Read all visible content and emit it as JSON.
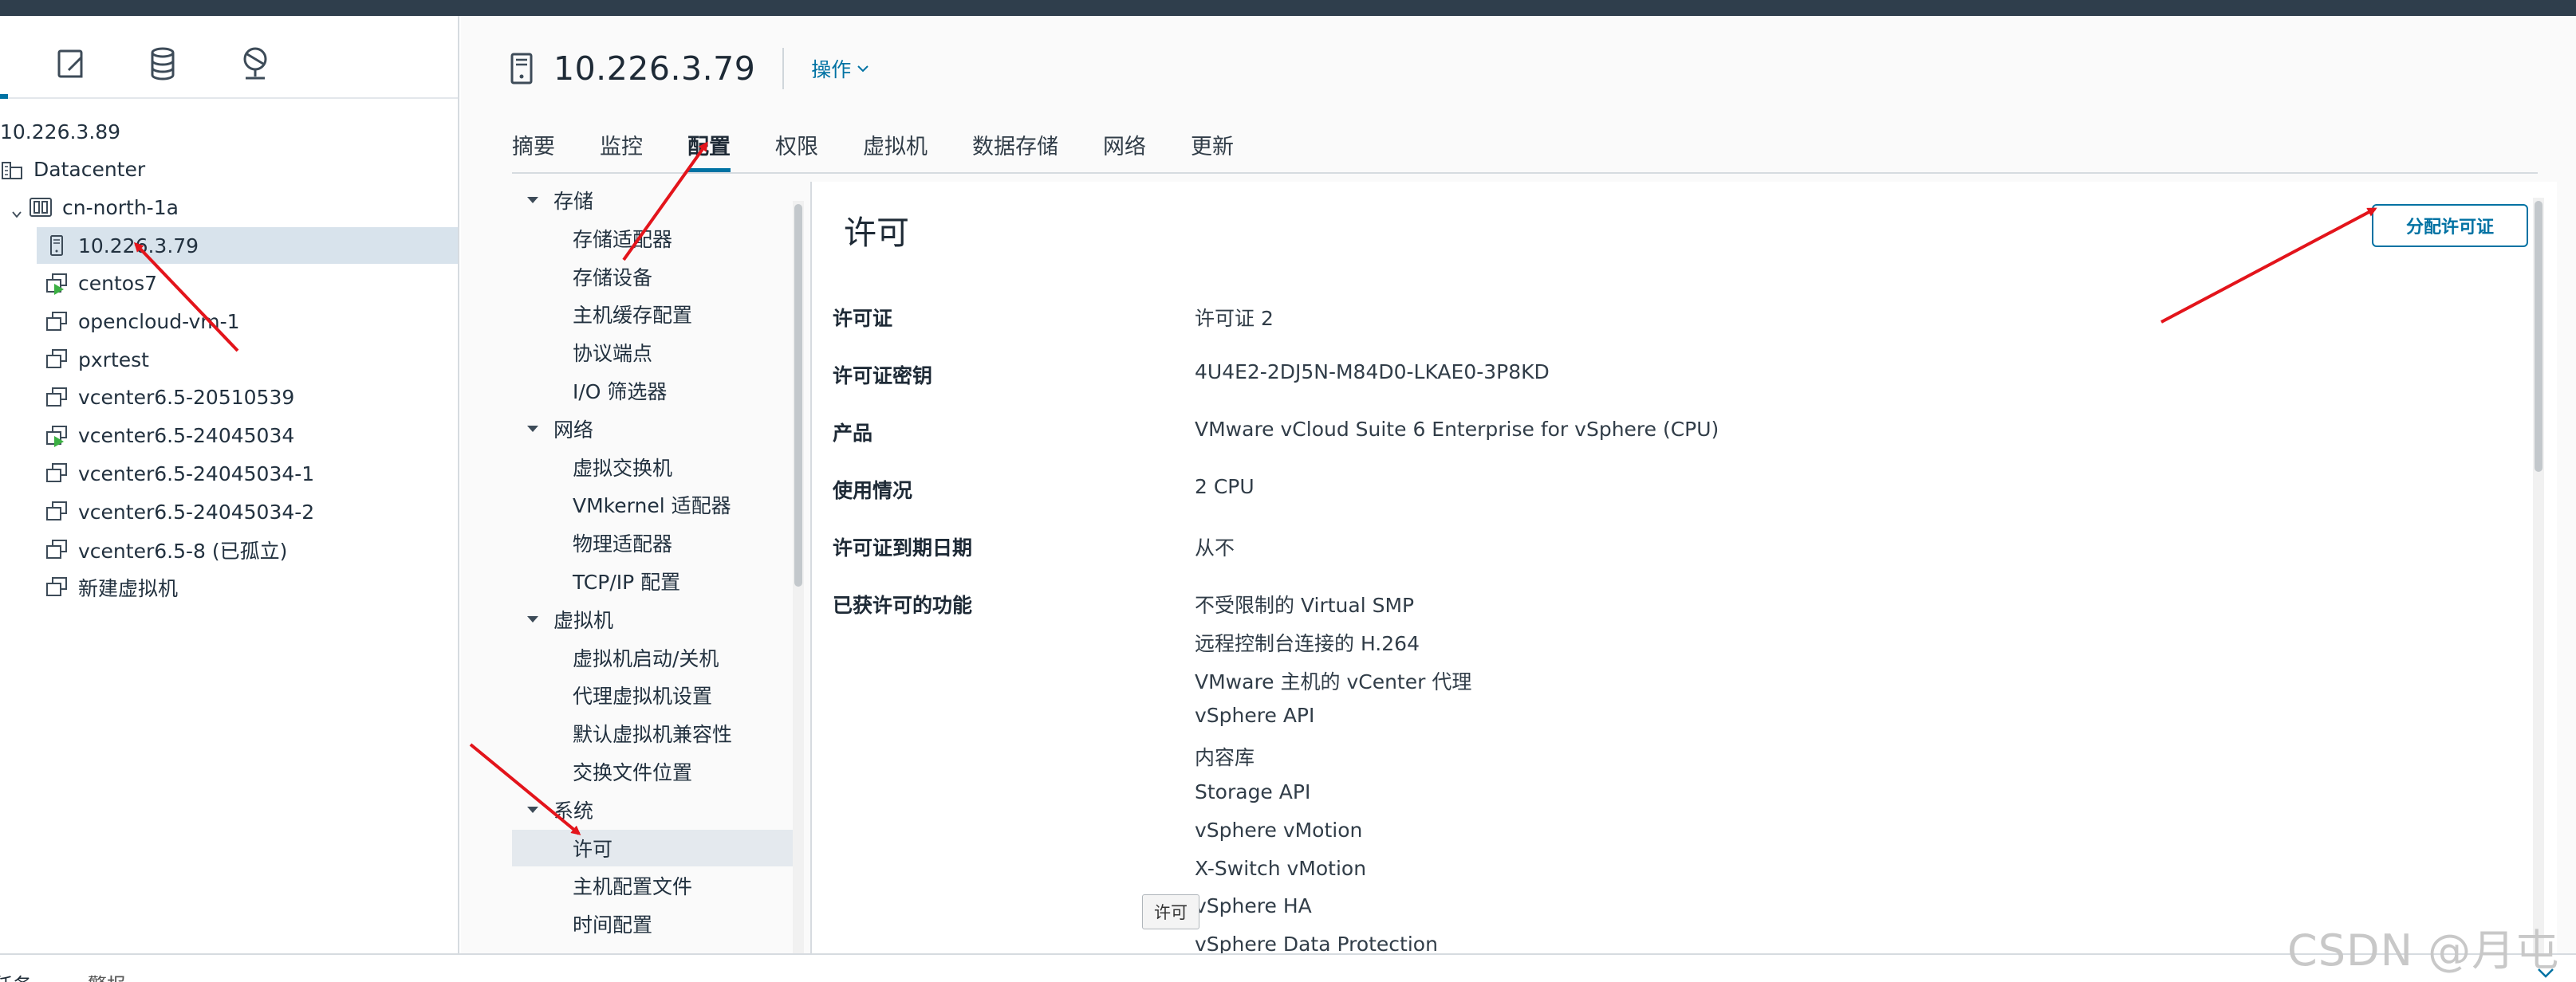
{
  "navigator": {
    "icons": [
      "vm-templates-icon",
      "storage-icon",
      "network-icon"
    ],
    "tree": [
      {
        "label": "10.226.3.89",
        "type": "vcenter"
      },
      {
        "label": "Datacenter",
        "type": "datacenter"
      },
      {
        "label": "cn-north-1a",
        "type": "cluster"
      },
      {
        "label": "10.226.3.79",
        "type": "host",
        "selected": true
      },
      {
        "label": "centos7",
        "type": "vm-on"
      },
      {
        "label": "opencloud-vm-1",
        "type": "vm"
      },
      {
        "label": "pxrtest",
        "type": "vm"
      },
      {
        "label": "vcenter6.5-20510539",
        "type": "vm"
      },
      {
        "label": "vcenter6.5-24045034",
        "type": "vm-on"
      },
      {
        "label": "vcenter6.5-24045034-1",
        "type": "vm"
      },
      {
        "label": "vcenter6.5-24045034-2",
        "type": "vm"
      },
      {
        "label": "vcenter6.5-8 (已孤立)",
        "type": "vm"
      },
      {
        "label": "新建虚拟机",
        "type": "vm"
      }
    ]
  },
  "header": {
    "title": "10.226.3.79",
    "actions_label": "操作"
  },
  "tabs": [
    "摘要",
    "监控",
    "配置",
    "权限",
    "虚拟机",
    "数据存储",
    "网络",
    "更新"
  ],
  "active_tab": "配置",
  "subnav": {
    "groups": [
      {
        "label": "存储",
        "items": [
          "存储适配器",
          "存储设备",
          "主机缓存配置",
          "协议端点",
          "I/O 筛选器"
        ]
      },
      {
        "label": "网络",
        "items": [
          "虚拟交换机",
          "VMkernel 适配器",
          "物理适配器",
          "TCP/IP 配置"
        ]
      },
      {
        "label": "虚拟机",
        "items": [
          "虚拟机启动/关机",
          "代理虚拟机设置",
          "默认虚拟机兼容性",
          "交换文件位置"
        ]
      },
      {
        "label": "系统",
        "items": [
          "许可",
          "主机配置文件",
          "时间配置"
        ]
      }
    ],
    "selected_item": "许可",
    "tooltip": "许可"
  },
  "license_panel": {
    "title": "许可",
    "assign_button": "分配许可证",
    "properties": [
      {
        "label": "许可证",
        "value": "许可证 2"
      },
      {
        "label": "许可证密钥",
        "value": "4U4E2-2DJ5N-M84D0-LKAE0-3P8KD"
      },
      {
        "label": "产品",
        "value": "VMware vCloud Suite 6 Enterprise for vSphere (CPU)"
      },
      {
        "label": "使用情况",
        "value": "2 CPU"
      },
      {
        "label": "许可证到期日期",
        "value": "从不"
      }
    ],
    "features_label": "已获许可的功能",
    "features": [
      "不受限制的 Virtual SMP",
      "远程控制台连接的 H.264",
      "VMware 主机的 vCenter 代理",
      "vSphere API",
      "内容库",
      "Storage API",
      "vSphere vMotion",
      "X-Switch vMotion",
      "vSphere HA",
      "vSphere Data Protection"
    ]
  },
  "bottombar": {
    "tabs": [
      "任务",
      "警报"
    ]
  },
  "watermark": "CSDN @月屯",
  "colors": {
    "accent": "#0072a3",
    "topbar": "#2f3e4c",
    "selected_row": "#d8e3ec",
    "annotation_arrow": "#e3141b"
  }
}
